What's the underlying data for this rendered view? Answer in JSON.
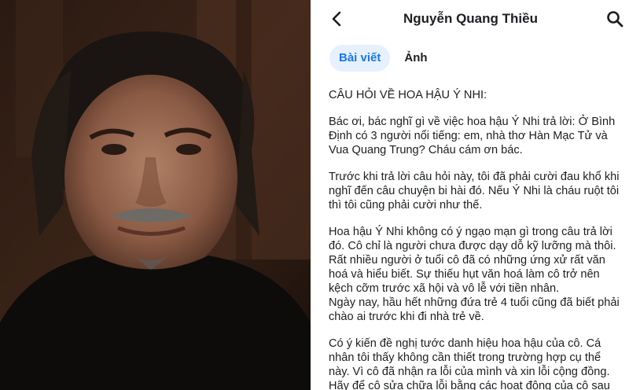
{
  "header": {
    "title": "Nguyễn Quang Thiều",
    "back_icon": "chevron-left-icon",
    "search_icon": "search-icon"
  },
  "tabs": [
    {
      "label": "Bài viết",
      "active": true
    },
    {
      "label": "Ảnh",
      "active": false
    }
  ],
  "post": {
    "heading": "CÂU HỎI VỀ HOA HẬU Ý NHI:",
    "paragraphs": [
      "Bác ơi, bác nghĩ gì về việc hoa hậu Ý Nhi trả lời: Ở Bình Định có 3 người nổi tiếng: em, nhà thơ Hàn Mạc Tử và Vua Quang Trung? Cháu cám ơn bác.",
      "Trước khi trả lời câu hỏi này, tôi đã phải cười đau khổ khi nghĩ đến câu chuyện bi hài đó. Nếu Ý Nhi là cháu ruột tôi thì tôi cũng phải cười như thế.",
      "Hoa hậu Ý Nhi không có ý ngạo mạn gì trong câu trả lời đó. Cô chỉ là người chưa được dạy dỗ kỹ lưỡng mà thôi. Rất nhiều người ở tuổi cô đã có những ứng xử rất văn hoá và hiểu biết. Sự thiếu hụt văn hoá làm cô trở nên kệch cỡm trước xã hội và vô lễ với tiền nhân.\nNgày nay, hầu hết những đứa trẻ 4 tuổi cũng đã biết phải chào ai trước khi đi nhà trẻ về.",
      "Có ý kiến đề nghị tước danh hiệu hoa hậu của cô. Cá nhân tôi thấy không cần thiết trong trường hợp cụ thể này. Vì cô đã nhận ra lỗi của mình và xin lỗi cộng đồng. Hãy để cô sửa chữa lỗi bằng các hoạt động của cô sau"
    ]
  },
  "colors": {
    "accent": "#1877f2",
    "active_tab_bg": "#e7f0fd",
    "text": "#1c1e21"
  }
}
